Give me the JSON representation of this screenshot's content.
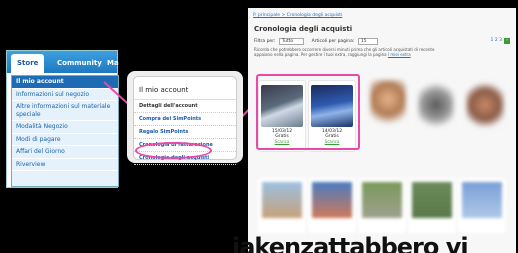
{
  "store_menu": {
    "tabs": [
      "Store",
      "Community",
      "Ma"
    ],
    "items": [
      "Il mio account",
      "Informazioni sul negozio",
      "Altre informazioni sul materiale speciale",
      "Modalità Negozio",
      "Modi di pagare",
      "Affari del Giorno",
      "Riverview"
    ]
  },
  "account_menu": {
    "title": "Il mio account",
    "items": [
      "Dettagli dell'account",
      "Compra dei SimPoints",
      "Regalo SimPoints",
      "Cronologia di fatturazione",
      "Cronologia degli acquisti"
    ]
  },
  "page": {
    "breadcrumb": "P. principale > Cronologia degli acquisti",
    "title": "Cronologia degli acquisti",
    "filter_label": "Filtra per:",
    "filter_value": "Tutto",
    "per_page_label": "Articoli per pagina:",
    "per_page_value": "15",
    "pager": "1 2 3",
    "note": "Ricorda che potrebbero occorrere diversi minuti prima che gli articoli acquistati di recente appaiano nella pagina. Per gestire i tuoi extra, raggiungi la pagina",
    "note_link": "I miei extra",
    "cards": [
      {
        "date": "15/03/12",
        "price": "Gratis",
        "link": "Scarica"
      },
      {
        "date": "14/03/12",
        "price": "Gratis",
        "link": "Scarica"
      }
    ]
  },
  "overlay_caption": "iakenzattabbero vi",
  "colors": {
    "accent": "#e94aa7",
    "menu_blue": "#1d6ab5",
    "link_blue": "#2a6fb5",
    "download_green": "#3aa034"
  }
}
